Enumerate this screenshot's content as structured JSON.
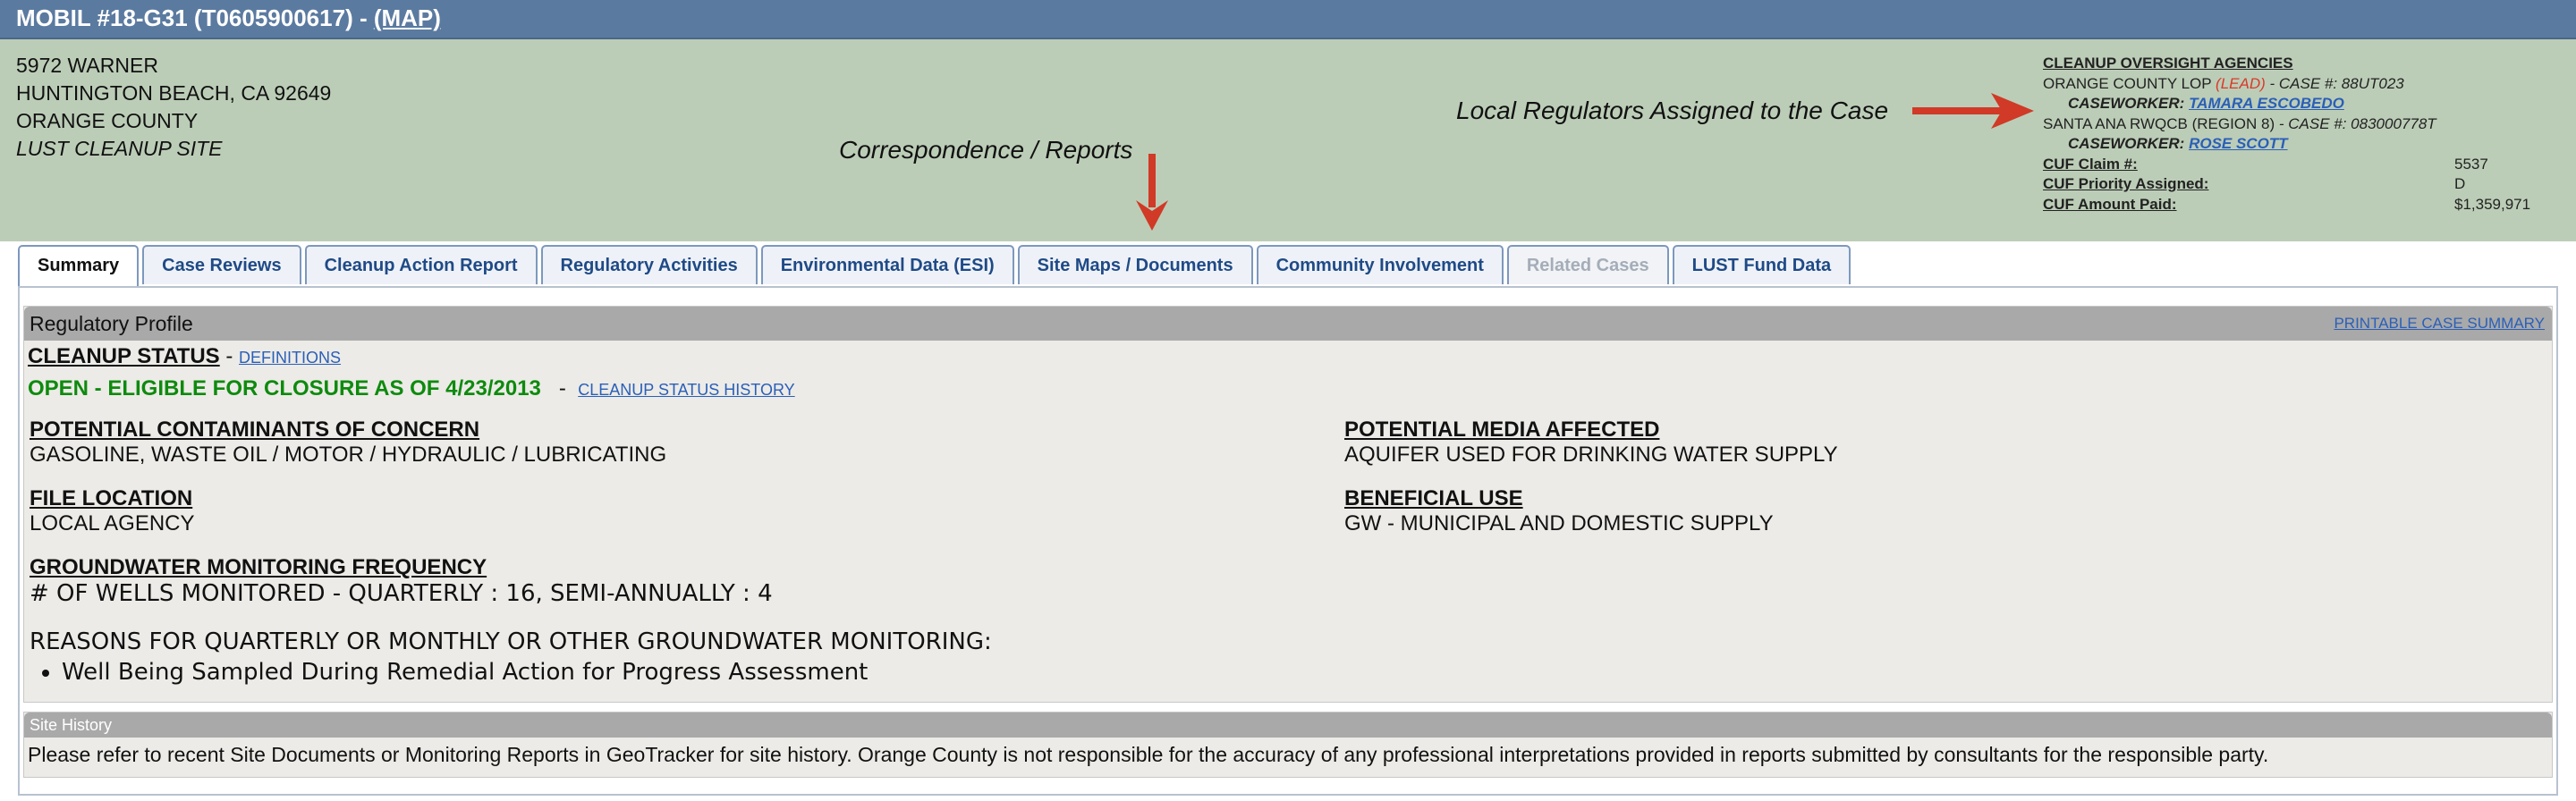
{
  "header": {
    "title": "MOBIL #18-G31 (T0605900617) - ",
    "map_link": "(MAP)"
  },
  "address": {
    "street": "5972 WARNER",
    "city": "HUNTINGTON BEACH, CA  92649",
    "county": "ORANGE COUNTY",
    "site_type": "LUST CLEANUP SITE"
  },
  "annotations": {
    "correspondence": "Correspondence / Reports",
    "local_regulators": "Local Regulators Assigned to the Case"
  },
  "agencies": {
    "heading": "CLEANUP OVERSIGHT AGENCIES",
    "agency1_name": "ORANGE COUNTY LOP ",
    "agency1_lead": "(LEAD)",
    "agency1_case": " - CASE #: 88UT023",
    "agency1_caseworker_label": "CASEWORKER: ",
    "agency1_caseworker": "TAMARA ESCOBEDO",
    "agency2_name": "SANTA ANA RWQCB (REGION 8)",
    "agency2_case": " - CASE #: 083000778T",
    "agency2_caseworker_label": "CASEWORKER: ",
    "agency2_caseworker": "ROSE SCOTT"
  },
  "cuf": [
    {
      "label": "CUF Claim #:",
      "value": "5537"
    },
    {
      "label": "CUF Priority Assigned:",
      "value": "D"
    },
    {
      "label": "CUF Amount Paid:",
      "value": "$1,359,971"
    }
  ],
  "tabs": [
    {
      "label": "Summary",
      "state": "active"
    },
    {
      "label": "Case Reviews",
      "state": "normal"
    },
    {
      "label": "Cleanup Action Report",
      "state": "normal"
    },
    {
      "label": "Regulatory Activities",
      "state": "normal"
    },
    {
      "label": "Environmental Data (ESI)",
      "state": "normal"
    },
    {
      "label": "Site Maps / Documents",
      "state": "normal"
    },
    {
      "label": "Community Involvement",
      "state": "normal"
    },
    {
      "label": "Related Cases",
      "state": "disabled"
    },
    {
      "label": "LUST Fund Data",
      "state": "normal"
    }
  ],
  "profile": {
    "title": "Regulatory Profile",
    "printable_link": "PRINTABLE CASE SUMMARY",
    "cleanup_status_label": "CLEANUP STATUS",
    "definitions_link": "DEFINITIONS",
    "status_value": "OPEN - ELIGIBLE FOR CLOSURE AS OF 4/23/2013",
    "status_history_link": "CLEANUP STATUS HISTORY",
    "contaminants_label": "POTENTIAL CONTAMINANTS OF CONCERN",
    "contaminants_value": "GASOLINE, WASTE OIL / MOTOR / HYDRAULIC / LUBRICATING",
    "media_label": "POTENTIAL MEDIA AFFECTED",
    "media_value": "AQUIFER USED FOR DRINKING WATER SUPPLY",
    "file_location_label": "FILE LOCATION",
    "file_location_value": "LOCAL AGENCY",
    "beneficial_use_label": "BENEFICIAL USE",
    "beneficial_use_value": "GW - MUNICIPAL AND DOMESTIC SUPPLY",
    "gw_freq_label": "GROUNDWATER MONITORING FREQUENCY",
    "wells_text": "# OF WELLS MONITORED - QUARTERLY : 16, SEMI-ANNUALLY : 4",
    "reasons_label": "REASONS FOR QUARTERLY OR MONTHLY OR OTHER GROUNDWATER MONITORING:",
    "reasons": [
      "Well Being Sampled During Remedial Action for Progress Assessment"
    ]
  },
  "site_history": {
    "title": "Site History",
    "text": "Please refer to recent Site Documents or Monitoring Reports in GeoTracker for site history. Orange County is not responsible for the accuracy of any professional interpretations provided in reports submitted by consultants for the responsible party."
  },
  "colors": {
    "title_bar": "#5b7aa0",
    "info_band": "#bccdb7",
    "status_green": "#0e8a0e",
    "lead_red": "#d93a2a",
    "arrow_red": "#d03a26",
    "link_blue": "#2a5fb8"
  }
}
